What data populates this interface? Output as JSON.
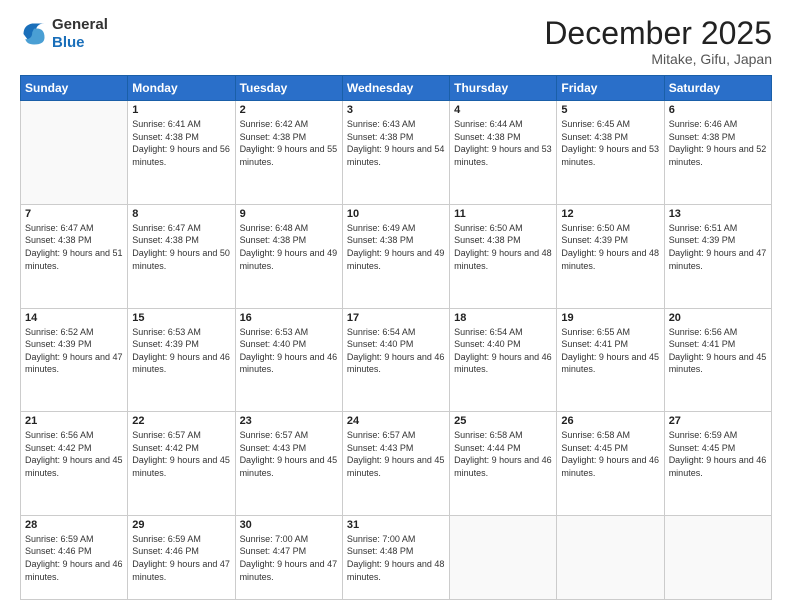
{
  "header": {
    "logo_line1": "General",
    "logo_line2": "Blue",
    "month_title": "December 2025",
    "location": "Mitake, Gifu, Japan"
  },
  "days_of_week": [
    "Sunday",
    "Monday",
    "Tuesday",
    "Wednesday",
    "Thursday",
    "Friday",
    "Saturday"
  ],
  "weeks": [
    [
      {
        "day": "",
        "empty": true
      },
      {
        "day": "1",
        "sunrise": "Sunrise: 6:41 AM",
        "sunset": "Sunset: 4:38 PM",
        "daylight": "Daylight: 9 hours and 56 minutes."
      },
      {
        "day": "2",
        "sunrise": "Sunrise: 6:42 AM",
        "sunset": "Sunset: 4:38 PM",
        "daylight": "Daylight: 9 hours and 55 minutes."
      },
      {
        "day": "3",
        "sunrise": "Sunrise: 6:43 AM",
        "sunset": "Sunset: 4:38 PM",
        "daylight": "Daylight: 9 hours and 54 minutes."
      },
      {
        "day": "4",
        "sunrise": "Sunrise: 6:44 AM",
        "sunset": "Sunset: 4:38 PM",
        "daylight": "Daylight: 9 hours and 53 minutes."
      },
      {
        "day": "5",
        "sunrise": "Sunrise: 6:45 AM",
        "sunset": "Sunset: 4:38 PM",
        "daylight": "Daylight: 9 hours and 53 minutes."
      },
      {
        "day": "6",
        "sunrise": "Sunrise: 6:46 AM",
        "sunset": "Sunset: 4:38 PM",
        "daylight": "Daylight: 9 hours and 52 minutes."
      }
    ],
    [
      {
        "day": "7",
        "sunrise": "Sunrise: 6:47 AM",
        "sunset": "Sunset: 4:38 PM",
        "daylight": "Daylight: 9 hours and 51 minutes."
      },
      {
        "day": "8",
        "sunrise": "Sunrise: 6:47 AM",
        "sunset": "Sunset: 4:38 PM",
        "daylight": "Daylight: 9 hours and 50 minutes."
      },
      {
        "day": "9",
        "sunrise": "Sunrise: 6:48 AM",
        "sunset": "Sunset: 4:38 PM",
        "daylight": "Daylight: 9 hours and 49 minutes."
      },
      {
        "day": "10",
        "sunrise": "Sunrise: 6:49 AM",
        "sunset": "Sunset: 4:38 PM",
        "daylight": "Daylight: 9 hours and 49 minutes."
      },
      {
        "day": "11",
        "sunrise": "Sunrise: 6:50 AM",
        "sunset": "Sunset: 4:38 PM",
        "daylight": "Daylight: 9 hours and 48 minutes."
      },
      {
        "day": "12",
        "sunrise": "Sunrise: 6:50 AM",
        "sunset": "Sunset: 4:39 PM",
        "daylight": "Daylight: 9 hours and 48 minutes."
      },
      {
        "day": "13",
        "sunrise": "Sunrise: 6:51 AM",
        "sunset": "Sunset: 4:39 PM",
        "daylight": "Daylight: 9 hours and 47 minutes."
      }
    ],
    [
      {
        "day": "14",
        "sunrise": "Sunrise: 6:52 AM",
        "sunset": "Sunset: 4:39 PM",
        "daylight": "Daylight: 9 hours and 47 minutes."
      },
      {
        "day": "15",
        "sunrise": "Sunrise: 6:53 AM",
        "sunset": "Sunset: 4:39 PM",
        "daylight": "Daylight: 9 hours and 46 minutes."
      },
      {
        "day": "16",
        "sunrise": "Sunrise: 6:53 AM",
        "sunset": "Sunset: 4:40 PM",
        "daylight": "Daylight: 9 hours and 46 minutes."
      },
      {
        "day": "17",
        "sunrise": "Sunrise: 6:54 AM",
        "sunset": "Sunset: 4:40 PM",
        "daylight": "Daylight: 9 hours and 46 minutes."
      },
      {
        "day": "18",
        "sunrise": "Sunrise: 6:54 AM",
        "sunset": "Sunset: 4:40 PM",
        "daylight": "Daylight: 9 hours and 46 minutes."
      },
      {
        "day": "19",
        "sunrise": "Sunrise: 6:55 AM",
        "sunset": "Sunset: 4:41 PM",
        "daylight": "Daylight: 9 hours and 45 minutes."
      },
      {
        "day": "20",
        "sunrise": "Sunrise: 6:56 AM",
        "sunset": "Sunset: 4:41 PM",
        "daylight": "Daylight: 9 hours and 45 minutes."
      }
    ],
    [
      {
        "day": "21",
        "sunrise": "Sunrise: 6:56 AM",
        "sunset": "Sunset: 4:42 PM",
        "daylight": "Daylight: 9 hours and 45 minutes."
      },
      {
        "day": "22",
        "sunrise": "Sunrise: 6:57 AM",
        "sunset": "Sunset: 4:42 PM",
        "daylight": "Daylight: 9 hours and 45 minutes."
      },
      {
        "day": "23",
        "sunrise": "Sunrise: 6:57 AM",
        "sunset": "Sunset: 4:43 PM",
        "daylight": "Daylight: 9 hours and 45 minutes."
      },
      {
        "day": "24",
        "sunrise": "Sunrise: 6:57 AM",
        "sunset": "Sunset: 4:43 PM",
        "daylight": "Daylight: 9 hours and 45 minutes."
      },
      {
        "day": "25",
        "sunrise": "Sunrise: 6:58 AM",
        "sunset": "Sunset: 4:44 PM",
        "daylight": "Daylight: 9 hours and 46 minutes."
      },
      {
        "day": "26",
        "sunrise": "Sunrise: 6:58 AM",
        "sunset": "Sunset: 4:45 PM",
        "daylight": "Daylight: 9 hours and 46 minutes."
      },
      {
        "day": "27",
        "sunrise": "Sunrise: 6:59 AM",
        "sunset": "Sunset: 4:45 PM",
        "daylight": "Daylight: 9 hours and 46 minutes."
      }
    ],
    [
      {
        "day": "28",
        "sunrise": "Sunrise: 6:59 AM",
        "sunset": "Sunset: 4:46 PM",
        "daylight": "Daylight: 9 hours and 46 minutes."
      },
      {
        "day": "29",
        "sunrise": "Sunrise: 6:59 AM",
        "sunset": "Sunset: 4:46 PM",
        "daylight": "Daylight: 9 hours and 47 minutes."
      },
      {
        "day": "30",
        "sunrise": "Sunrise: 7:00 AM",
        "sunset": "Sunset: 4:47 PM",
        "daylight": "Daylight: 9 hours and 47 minutes."
      },
      {
        "day": "31",
        "sunrise": "Sunrise: 7:00 AM",
        "sunset": "Sunset: 4:48 PM",
        "daylight": "Daylight: 9 hours and 48 minutes."
      },
      {
        "day": "",
        "empty": true
      },
      {
        "day": "",
        "empty": true
      },
      {
        "day": "",
        "empty": true
      }
    ]
  ]
}
